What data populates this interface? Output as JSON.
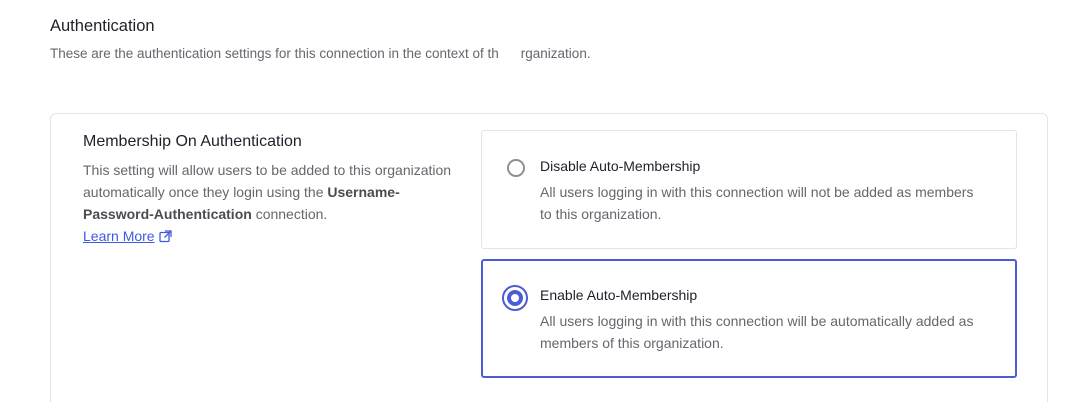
{
  "section": {
    "title": "Authentication",
    "description_before": "These are the authentication settings for this connection in the context of th",
    "description_after": "rganization."
  },
  "setting": {
    "title": "Membership On Authentication",
    "desc_part1": "This setting will allow users to be added to this organization automatically once they login using the",
    "connection_name": "Username-Password-Authentication",
    "desc_part2": "connection.",
    "learn_more": "Learn More"
  },
  "options": [
    {
      "label": "Disable Auto-Membership",
      "description": "All users logging in with this connection will not be added as members to this organization.",
      "selected": false
    },
    {
      "label": "Enable Auto-Membership",
      "description": "All users logging in with this connection will be automatically added as members of this organization.",
      "selected": true
    }
  ],
  "colors": {
    "accent": "#4b5dd1",
    "link": "#3f59e4",
    "text_primary": "#1e212a",
    "text_secondary": "#65676e",
    "border": "#e3e4e7"
  },
  "icons": {
    "learn_more": "external-link-icon"
  }
}
